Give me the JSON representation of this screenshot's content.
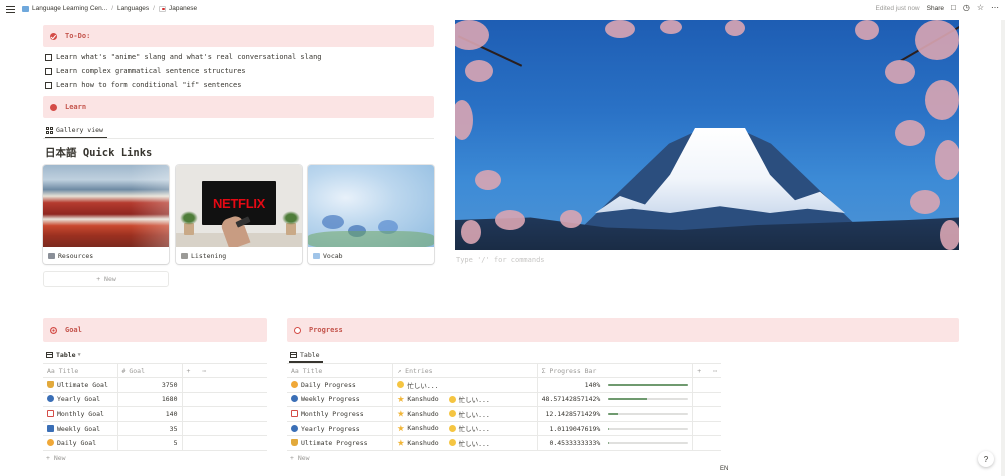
{
  "topbar": {
    "breadcrumbs": [
      "Language Learning Cen...",
      "Languages",
      "Japanese"
    ],
    "separator": "/",
    "edited": "Edited just now",
    "share": "Share"
  },
  "todo": {
    "title": "To-Do:",
    "items": [
      "Learn what's \"anime\" slang and what's real conversational slang",
      "Learn complex grammatical sentence structures",
      "Learn how to form conditional \"if\" sentences"
    ]
  },
  "learn": {
    "title": "Learn",
    "view_tab": "Gallery view",
    "heading": "日本語 Quick Links",
    "cards": [
      {
        "label": "Resources"
      },
      {
        "label": "Listening",
        "logo_text": "NETFLIX"
      },
      {
        "label": "Vocab"
      }
    ],
    "new_label": "+ New"
  },
  "command_hint": "Type '/' for commands",
  "goal": {
    "title": "Goal",
    "view_tab": "Table",
    "columns": [
      "Aa Title",
      "# Goal"
    ],
    "rows": [
      {
        "title": "Ultimate Goal",
        "goal": "3750"
      },
      {
        "title": "Yearly Goal",
        "goal": "1680"
      },
      {
        "title": "Monthly Goal",
        "goal": "140"
      },
      {
        "title": "Weekly Goal",
        "goal": "35"
      },
      {
        "title": "Daily Goal",
        "goal": "5"
      }
    ],
    "new_label": "+ New"
  },
  "progress": {
    "title": "Progress",
    "view_tab": "Table",
    "columns": [
      "Aa Title",
      "↗ Entries",
      "Σ Progress Bar"
    ],
    "rows": [
      {
        "title": "Daily Progress",
        "entries": [
          "忙しい..."
        ],
        "value": "140%",
        "fill": 1.0
      },
      {
        "title": "Weekly Progress",
        "entries": [
          "Kanshudo",
          "忙しい..."
        ],
        "value": "48.57142857142%",
        "fill": 0.4857
      },
      {
        "title": "Monthly Progress",
        "entries": [
          "Kanshudo",
          "忙しい..."
        ],
        "value": "12.1428571429%",
        "fill": 0.1214
      },
      {
        "title": "Yearly Progress",
        "entries": [
          "Kanshudo",
          "忙しい..."
        ],
        "value": "1.0119047619%",
        "fill": 0.0101
      },
      {
        "title": "Ultimate Progress",
        "entries": [
          "Kanshudo",
          "忙しい..."
        ],
        "value": "0.4533333333%",
        "fill": 0.0045
      }
    ],
    "new_label": "+ New"
  },
  "footer": {
    "lang": "EN",
    "help": "?"
  }
}
